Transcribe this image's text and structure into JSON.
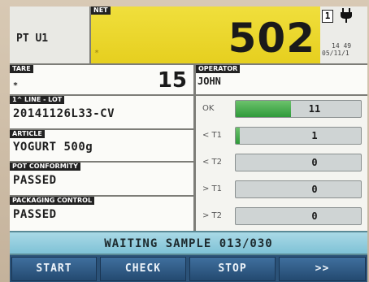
{
  "header": {
    "scale_id": "PT U1",
    "net_tag": "NET",
    "net_marker": "*",
    "net_weight": "502",
    "channel": "1",
    "power_icon": "plug-icon",
    "time": "14 49",
    "date": "05/11/1"
  },
  "fields": {
    "tare": {
      "label": "TARE",
      "value": "15",
      "marker": "*"
    },
    "lot": {
      "label": "1^ LINE - LOT",
      "value": "20141126L33-CV"
    },
    "article": {
      "label": "ARTICLE",
      "value": "YOGURT 500g"
    },
    "pot_conformity": {
      "label": "POT CONFORMITY",
      "value": "PASSED"
    },
    "packaging_control": {
      "label": "PACKAGING CONTROL",
      "value": "PASSED"
    }
  },
  "operator": {
    "label": "OPERATOR",
    "value": "JOHN"
  },
  "counters": [
    {
      "label": "OK",
      "count": "11",
      "fill": 0.44
    },
    {
      "label": "< T1",
      "count": "1",
      "fill": 0.03
    },
    {
      "label": "< T2",
      "count": "0",
      "fill": 0
    },
    {
      "label": "> T1",
      "count": "0",
      "fill": 0
    },
    {
      "label": "> T2",
      "count": "0",
      "fill": 0
    }
  ],
  "status": {
    "text": "WAITING SAMPLE 013/030"
  },
  "buttons": {
    "start": "START",
    "check": "CHECK",
    "stop": "STOP",
    "next": ">>"
  },
  "colors": {
    "net_bg": "#e6cf1f",
    "counter_fill": "#2f9a3a",
    "status_bg": "#7fc2d6",
    "button_bg": "#244a70"
  }
}
